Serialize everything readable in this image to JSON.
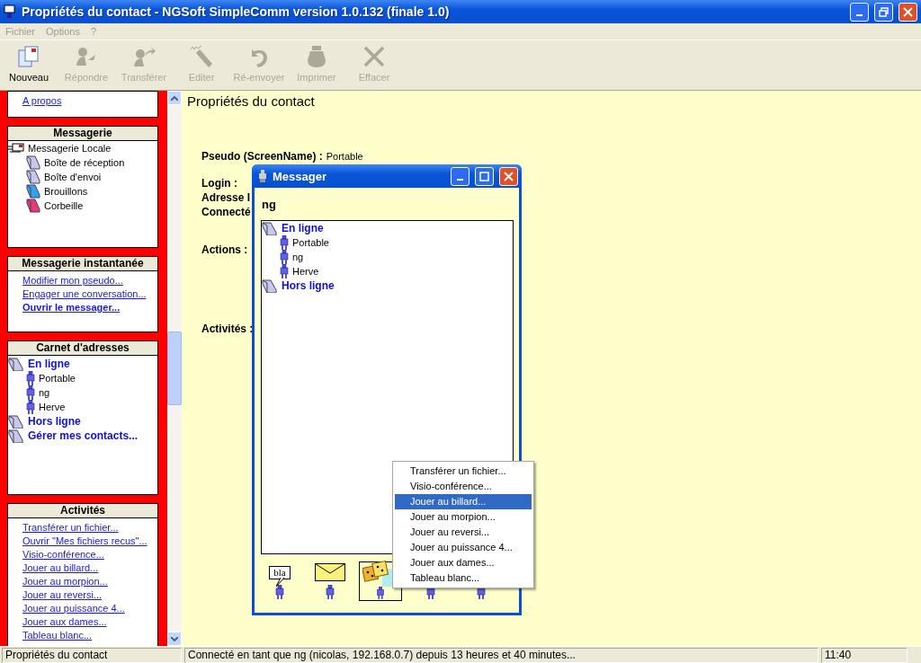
{
  "window": {
    "title": "Propriétés du contact - NGSoft SimpleComm version 1.0.132 (finale 1.0)"
  },
  "menu_bar": [
    "Fichier",
    "Options",
    "?"
  ],
  "toolbar": [
    {
      "label": "Nouveau",
      "kind": "new",
      "disabled": false
    },
    {
      "label": "Répondre",
      "kind": "reply",
      "disabled": true
    },
    {
      "label": "Transférer",
      "kind": "forward",
      "disabled": true
    },
    {
      "label": "Editer",
      "kind": "edit",
      "disabled": true
    },
    {
      "label": "Ré-envoyer",
      "kind": "resend",
      "disabled": true
    },
    {
      "label": "Imprimer",
      "kind": "print",
      "disabled": true
    },
    {
      "label": "Effacer",
      "kind": "delete",
      "disabled": true
    }
  ],
  "sidebar": {
    "panels": [
      {
        "kind": "links",
        "links": [
          {
            "label": "A propos",
            "bold": false
          }
        ]
      },
      {
        "kind": "tree",
        "title": "Messagerie",
        "root": {
          "label": "Messagerie Locale",
          "children": [
            {
              "label": "Boîte de réception"
            },
            {
              "label": "Boîte d'envoi"
            },
            {
              "label": "Brouillons"
            },
            {
              "label": "Corbeille"
            }
          ]
        }
      },
      {
        "kind": "links",
        "title": "Messagerie instantanée",
        "links": [
          {
            "label": "Modifier mon pseudo...",
            "bold": false
          },
          {
            "label": "Engager une conversation...",
            "bold": false
          },
          {
            "label": "Ouvrir le messager...",
            "bold": true
          }
        ]
      },
      {
        "kind": "contacts",
        "title": "Carnet d'adresses",
        "groups": [
          {
            "label": "En ligne",
            "children": [
              "Portable",
              "ng",
              "Herve"
            ]
          },
          {
            "label": "Hors ligne"
          },
          {
            "label": "Gérer mes contacts..."
          }
        ]
      },
      {
        "kind": "links",
        "title": "Activités",
        "links": [
          {
            "label": "Transférer un fichier...",
            "bold": false
          },
          {
            "label": "Ouvrir \"Mes fichiers recus\"...",
            "bold": false
          },
          {
            "label": "Visio-conférence...",
            "bold": false
          },
          {
            "label": "Jouer au billard...",
            "bold": false
          },
          {
            "label": "Jouer au morpion...",
            "bold": false
          },
          {
            "label": "Jouer au reversi...",
            "bold": false
          },
          {
            "label": "Jouer au puissance 4...",
            "bold": false
          },
          {
            "label": "Jouer aux dames...",
            "bold": false
          },
          {
            "label": "Tableau blanc...",
            "bold": false
          }
        ]
      }
    ]
  },
  "content": {
    "title": "Propriétés du contact",
    "fields": [
      {
        "label": "Pseudo (ScreenName) :",
        "value": "Portable"
      },
      {
        "label": "Login :"
      },
      {
        "label": "Adresse I"
      },
      {
        "label": "Connecté"
      }
    ],
    "sections": [
      "Actions :",
      "Activités :"
    ]
  },
  "messager": {
    "title": "Messager",
    "user": "ng",
    "groups": [
      {
        "label": "En ligne",
        "children": [
          "Portable",
          "ng",
          "Herve"
        ]
      },
      {
        "label": "Hors ligne"
      }
    ],
    "tools": [
      {
        "kind": "chat",
        "text": "bla",
        "selected": false
      },
      {
        "kind": "mail",
        "selected": false
      },
      {
        "kind": "games",
        "selected": true
      },
      {
        "kind": "blank",
        "selected": false
      },
      {
        "kind": "blank",
        "selected": false
      }
    ]
  },
  "context_menu": {
    "items": [
      {
        "label": "Transférer un fichier...",
        "selected": false
      },
      {
        "label": "Visio-conférence...",
        "selected": false
      },
      {
        "label": "Jouer au billard...",
        "selected": true
      },
      {
        "label": "Jouer au morpion...",
        "selected": false
      },
      {
        "label": "Jouer au reversi...",
        "selected": false
      },
      {
        "label": "Jouer au puissance 4...",
        "selected": false
      },
      {
        "label": "Jouer aux dames...",
        "selected": false
      },
      {
        "label": "Tableau blanc...",
        "selected": false
      }
    ]
  },
  "status_bar": [
    "Propriétés du contact",
    "Connecté en tant que ng (nicolas, 192.168.0.7) depuis 13 heures et 40 minutes...",
    "11:40"
  ]
}
